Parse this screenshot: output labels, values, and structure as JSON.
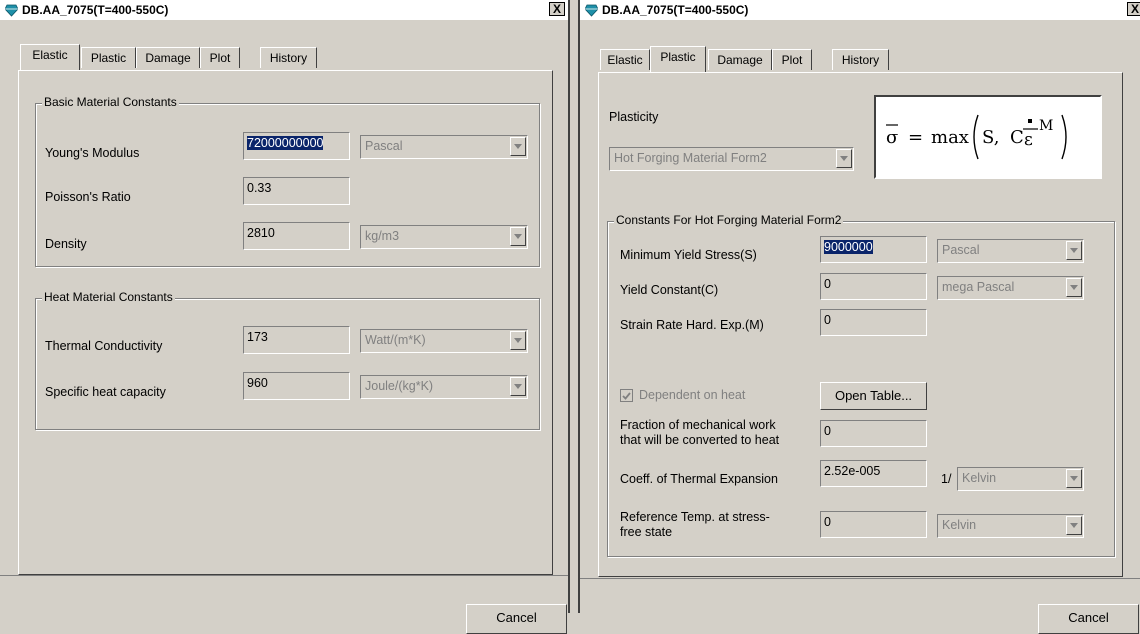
{
  "left": {
    "title": "DB.AA_7075(T=400-550C)",
    "close": "X",
    "tabs": [
      "Elastic",
      "Plastic",
      "Damage",
      "Plot",
      "History"
    ],
    "active_tab": "Elastic",
    "basic_group": "Basic Material Constants",
    "youngs_label": "Young's Modulus",
    "youngs_value": "72000000000",
    "youngs_unit": "Pascal",
    "poisson_label": "Poisson's Ratio",
    "poisson_value": "0.33",
    "density_label": "Density",
    "density_value": "2810",
    "density_unit": "kg/m3",
    "heat_group": "Heat Material Constants",
    "thermal_label": "Thermal Conductivity",
    "thermal_value": "173",
    "thermal_unit": "Watt/(m*K)",
    "specific_label": "Specific heat capacity",
    "specific_value": "960",
    "specific_unit": "Joule/(kg*K)",
    "cancel": "Cancel"
  },
  "right": {
    "title": "DB.AA_7075(T=400-550C)",
    "close": "X",
    "tabs": [
      "Elastic",
      "Plastic",
      "Damage",
      "Plot",
      "History"
    ],
    "active_tab": "Plastic",
    "plasticity_label": "Plasticity",
    "plasticity_model": "Hot Forging Material Form2",
    "formula": {
      "lhs": "σ",
      "equals": "=",
      "func": "max",
      "arg1": "S,",
      "coef": "C",
      "rate_symbol": "ε",
      "exponent": "M"
    },
    "constants_group": "Constants For Hot Forging Material Form2",
    "min_yield_label": "Minimum Yield Stress(S)",
    "min_yield_value": "9000000",
    "min_yield_unit": "Pascal",
    "yield_const_label": "Yield Constant(C)",
    "yield_const_value": "0",
    "yield_const_unit": "mega Pascal",
    "strain_rate_label": "Strain Rate Hard. Exp.(M)",
    "strain_rate_value": "0",
    "dependent_label": "Dependent on heat",
    "dependent_checked": true,
    "open_table": "Open Table...",
    "fraction_label_1": "Fraction of mechanical work",
    "fraction_label_2": "that will be converted to heat",
    "fraction_value": "0",
    "thermal_exp_label": "Coeff. of Thermal Expansion",
    "thermal_exp_value": "2.52e-005",
    "thermal_exp_prefix": "1/",
    "thermal_exp_unit": "Kelvin",
    "ref_temp_label_1": "Reference Temp. at stress-",
    "ref_temp_label_2": "free state",
    "ref_temp_value": "0",
    "ref_temp_unit": "Kelvin",
    "cancel": "Cancel"
  },
  "colors": {
    "selection": "#0a246a",
    "face": "#d4d0c8",
    "icon": "#1e8fa8"
  }
}
